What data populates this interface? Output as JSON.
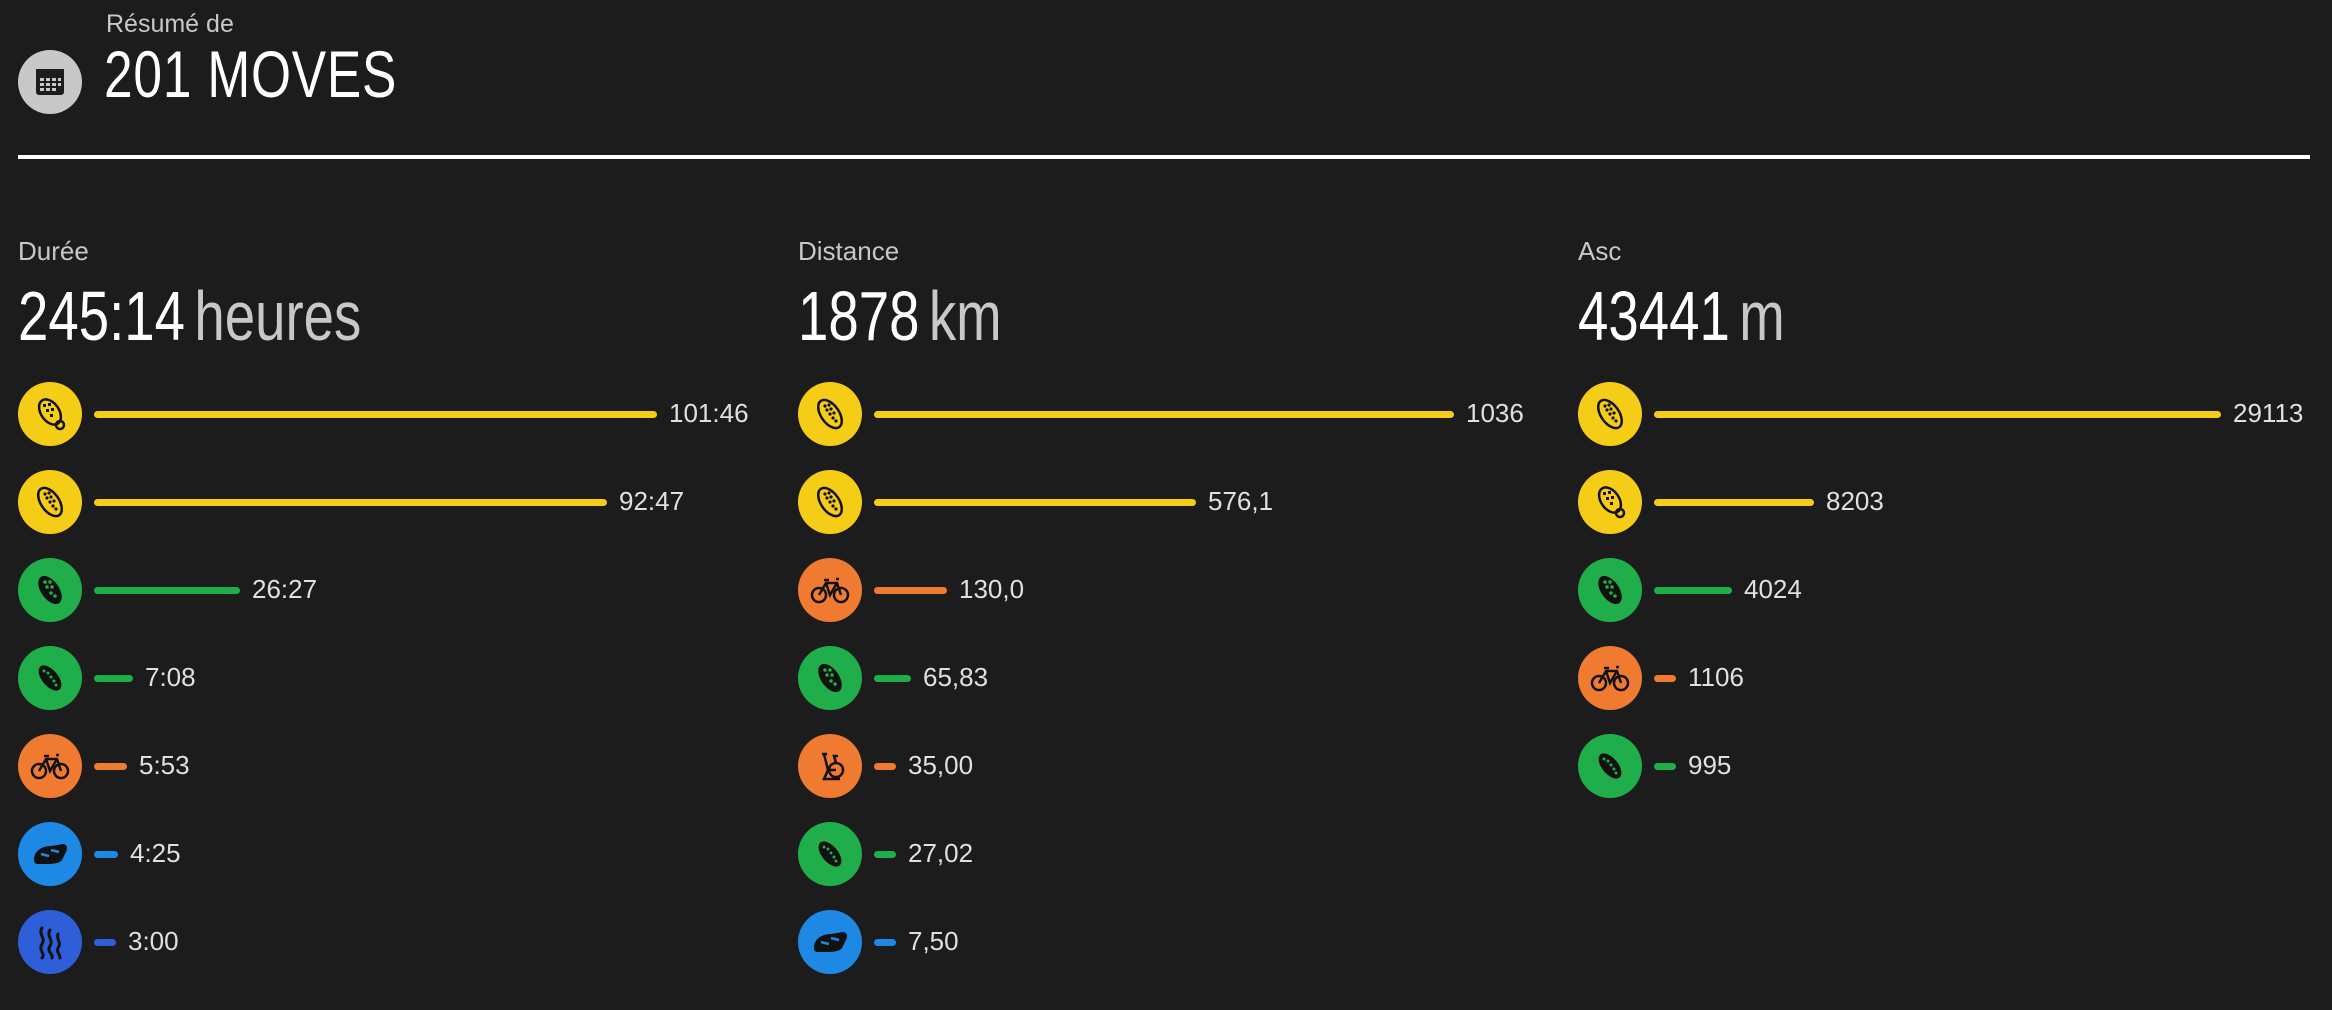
{
  "header": {
    "subtitle": "Résumé de",
    "title": "201 MOVES",
    "icon": "calendar-icon"
  },
  "colors": {
    "yellow": "#f5cc16",
    "green": "#1fae4a",
    "orange": "#f07a2f",
    "blue": "#1e88e5",
    "royal": "#2f5fd8",
    "header_icon_bg": "#c8c8c8",
    "background": "#1c1c1c"
  },
  "columns": [
    {
      "label": "Durée",
      "total_value": "245:14",
      "total_unit": "heures",
      "rows": [
        {
          "value": "101:46",
          "color": "yellow",
          "icon": "trail-shoe-icon",
          "fraction": 1.0
        },
        {
          "value": "92:47",
          "color": "yellow",
          "icon": "running-shoe-icon",
          "fraction": 0.912
        },
        {
          "value": "26:27",
          "color": "green",
          "icon": "hiking-boot-icon",
          "fraction": 0.26
        },
        {
          "value": "7:08",
          "color": "green",
          "icon": "walking-shoe-icon",
          "fraction": 0.07
        },
        {
          "value": "5:53",
          "color": "orange",
          "icon": "bicycle-icon",
          "fraction": 0.058
        },
        {
          "value": "4:25",
          "color": "blue",
          "icon": "ski-boot-icon",
          "fraction": 0.043
        },
        {
          "value": "3:00",
          "color": "royal",
          "icon": "swimming-icon",
          "fraction": 0.03
        }
      ]
    },
    {
      "label": "Distance",
      "total_value": "1878",
      "total_unit": "km",
      "rows": [
        {
          "value": "1036",
          "color": "yellow",
          "icon": "running-shoe-icon",
          "fraction": 1.0
        },
        {
          "value": "576,1",
          "color": "yellow",
          "icon": "running-shoe-icon",
          "fraction": 0.556
        },
        {
          "value": "130,0",
          "color": "orange",
          "icon": "bicycle-icon",
          "fraction": 0.126
        },
        {
          "value": "65,83",
          "color": "green",
          "icon": "hiking-boot-icon",
          "fraction": 0.064
        },
        {
          "value": "35,00",
          "color": "orange",
          "icon": "indoor-bike-icon",
          "fraction": 0.034
        },
        {
          "value": "27,02",
          "color": "green",
          "icon": "walking-shoe-icon",
          "fraction": 0.026
        },
        {
          "value": "7,50",
          "color": "blue",
          "icon": "ski-boot-icon",
          "fraction": 0.0072
        }
      ]
    },
    {
      "label": "Asc",
      "total_value": "43441",
      "total_unit": "m",
      "rows": [
        {
          "value": "29113",
          "color": "yellow",
          "icon": "running-shoe-icon",
          "fraction": 1.0
        },
        {
          "value": "8203",
          "color": "yellow",
          "icon": "trail-shoe-icon",
          "fraction": 0.282
        },
        {
          "value": "4024",
          "color": "green",
          "icon": "hiking-boot-icon",
          "fraction": 0.138
        },
        {
          "value": "1106",
          "color": "orange",
          "icon": "bicycle-icon",
          "fraction": 0.038
        },
        {
          "value": "995",
          "color": "green",
          "icon": "walking-shoe-icon",
          "fraction": 0.034
        }
      ]
    }
  ]
}
